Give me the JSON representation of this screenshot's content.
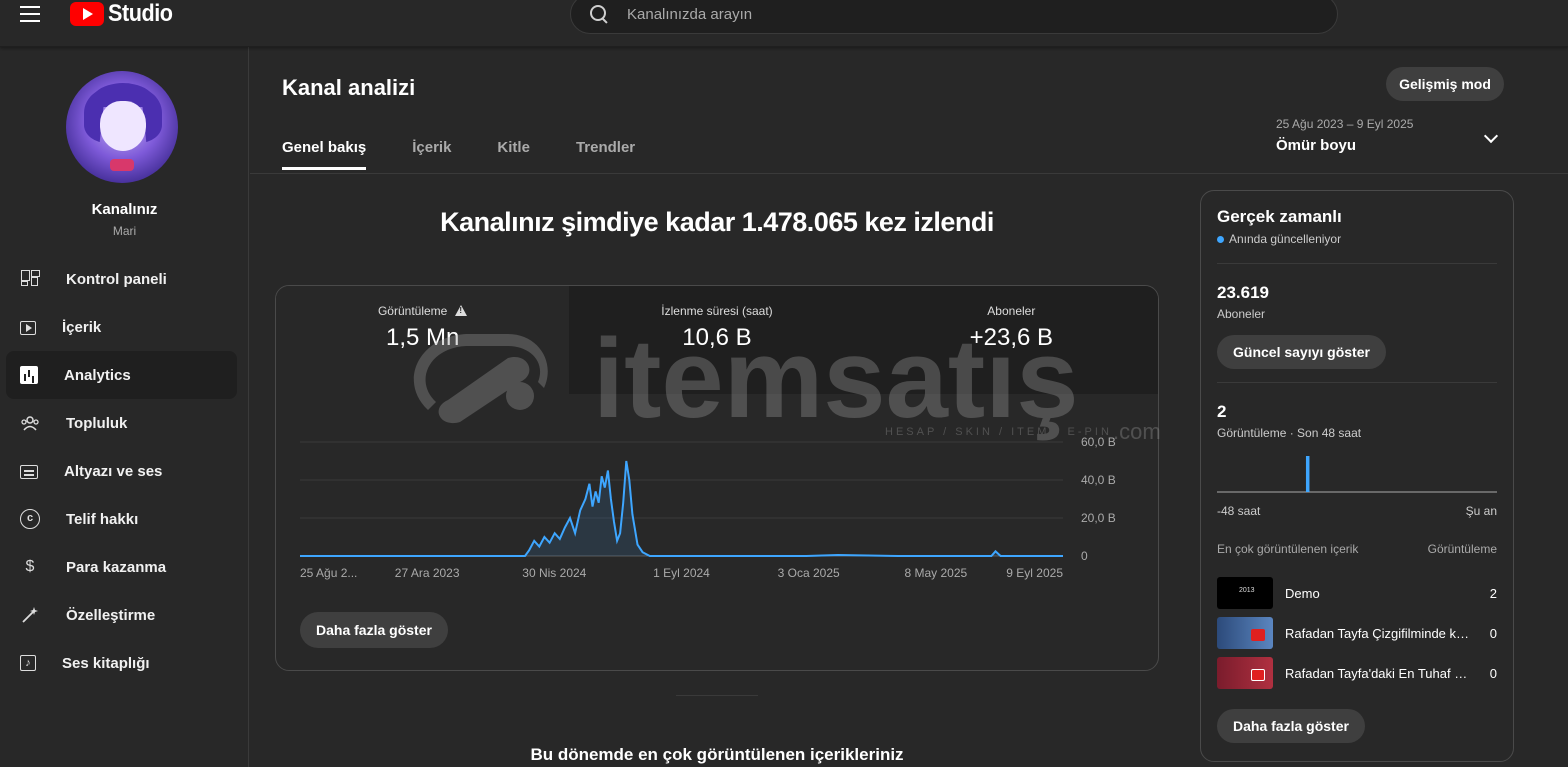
{
  "topbar": {
    "logo_text": "Studio",
    "search_placeholder": "Kanalınızda arayın"
  },
  "channel": {
    "title": "Kanalınız",
    "name": "Mari"
  },
  "sidebar": {
    "items": [
      {
        "label": "Kontrol paneli",
        "icon": "dashboard-icon"
      },
      {
        "label": "İçerik",
        "icon": "content-icon"
      },
      {
        "label": "Analytics",
        "icon": "analytics-icon",
        "active": true
      },
      {
        "label": "Topluluk",
        "icon": "community-icon"
      },
      {
        "label": "Altyazı ve ses",
        "icon": "subtitles-icon"
      },
      {
        "label": "Telif hakkı",
        "icon": "copyright-icon"
      },
      {
        "label": "Para kazanma",
        "icon": "dollar-icon"
      },
      {
        "label": "Özelleştirme",
        "icon": "magic-wand-icon"
      },
      {
        "label": "Ses kitaplığı",
        "icon": "audio-library-icon"
      }
    ]
  },
  "main": {
    "title": "Kanal analizi",
    "advanced_button": "Gelişmiş mod",
    "tabs": [
      "Genel bakış",
      "İçerik",
      "Kitle",
      "Trendler"
    ],
    "active_tab": "Genel bakış",
    "date_range": {
      "range": "25 Ağu 2023 – 9 Eyl 2025",
      "label": "Ömür boyu"
    },
    "headline": "Kanalınız şimdiye kadar 1.478.065 kez izlendi",
    "metrics": [
      {
        "label": "Görüntüleme",
        "value": "1,5 Mn",
        "warning": true
      },
      {
        "label": "İzlenme süresi (saat)",
        "value": "10,6 B"
      },
      {
        "label": "Aboneler",
        "value": "+23,6 B"
      }
    ],
    "more_button": "Daha fazla göster",
    "bottom_title": "Bu dönemde en çok görüntülenen içerikleriniz"
  },
  "chart_data": {
    "type": "line",
    "series": [
      {
        "name": "Görüntüleme",
        "color": "#3ea6ff",
        "x": [
          "2023-08-25",
          "2023-10-01",
          "2023-12-01",
          "2024-02-01",
          "2024-04-01",
          "2024-04-05",
          "2024-04-10",
          "2024-04-15",
          "2024-04-20",
          "2024-04-25",
          "2024-04-30",
          "2024-05-05",
          "2024-05-10",
          "2024-05-15",
          "2024-05-20",
          "2024-05-25",
          "2024-05-30",
          "2024-06-03",
          "2024-06-06",
          "2024-06-09",
          "2024-06-12",
          "2024-06-15",
          "2024-06-18",
          "2024-06-21",
          "2024-06-24",
          "2024-06-27",
          "2024-06-30",
          "2024-07-03",
          "2024-07-06",
          "2024-07-09",
          "2024-07-12",
          "2024-07-15",
          "2024-07-20",
          "2024-07-25",
          "2024-08-01",
          "2024-09-01",
          "2024-11-01",
          "2025-01-01",
          "2025-02-01",
          "2025-04-01",
          "2025-06-01",
          "2025-07-01",
          "2025-07-05",
          "2025-07-10",
          "2025-09-09"
        ],
        "values": [
          0,
          0,
          0,
          0,
          0,
          3,
          8,
          5,
          10,
          7,
          12,
          9,
          15,
          20,
          12,
          24,
          30,
          38,
          26,
          34,
          28,
          42,
          36,
          45,
          30,
          18,
          8,
          12,
          28,
          50,
          40,
          22,
          6,
          2,
          0,
          0,
          0,
          0,
          0.5,
          0,
          0,
          0,
          2.5,
          0,
          0
        ]
      }
    ],
    "x_tick_labels": [
      "25 Ağu 2...",
      "27 Ara 2023",
      "30 Nis 2024",
      "1 Eyl 2024",
      "3 Oca 2025",
      "8 May 2025",
      "9 Eyl 2025"
    ],
    "y_tick_labels": [
      "60,0 B",
      "40,0 B",
      "20,0 B",
      "0"
    ],
    "ylim": [
      0,
      60
    ],
    "grid": true,
    "y_axis_side": "right"
  },
  "realtime": {
    "title": "Gerçek zamanlı",
    "live_text": "Anında güncelleniyor",
    "subscribers_value": "23.619",
    "subscribers_label": "Aboneler",
    "show_count_button": "Güncel sayıyı göster",
    "views_value": "2",
    "views_label": "Görüntüleme · Son 48 saat",
    "axis_left": "-48 saat",
    "axis_right": "Şu an",
    "table_header_left": "En çok görüntülenen içerik",
    "table_header_right": "Görüntüleme",
    "top_content": [
      {
        "title": "Demo",
        "views": "2",
        "thumb_text": "2013"
      },
      {
        "title": "Rafadan Tayfa Çizgifilminde k…",
        "views": "0"
      },
      {
        "title": "Rafadan Tayfa'daki En Tuhaf …",
        "views": "0"
      }
    ],
    "more_button": "Daha fazla göster",
    "bar_chart": {
      "type": "bar",
      "bars_count": 48,
      "values_hour_index": {
        "15": 2
      },
      "color": "#3ea6ff"
    }
  },
  "watermark": {
    "brand": "itemsatış",
    "tagline": "HESAP / SKIN / ITEM / E-PIN",
    "suffix": ".com"
  }
}
